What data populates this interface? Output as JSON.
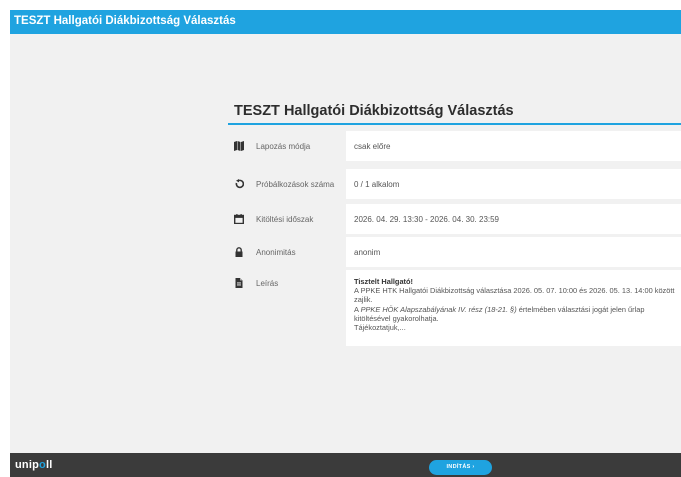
{
  "header": {
    "title": "TESZT Hallgatói Diákbizottság Választás"
  },
  "form": {
    "title": "TESZT Hallgatói Diákbizottság Választás",
    "rows": [
      {
        "icon": "map-book-icon",
        "label": "Lapozás módja",
        "value": "csak előre"
      },
      {
        "icon": "undo-arrow-icon",
        "label": "Próbálkozások száma",
        "value": "0 / 1 alkalom"
      },
      {
        "icon": "calendar-icon",
        "label": "Kitöltési időszak",
        "value": "2026. 04. 29. 13:30 - 2026. 04. 30. 23:59"
      },
      {
        "icon": "lock-icon",
        "label": "Anonimitás",
        "value": "anonim"
      },
      {
        "icon": "document-icon",
        "label": "Leírás"
      }
    ],
    "description": {
      "heading": "Tisztelt Hallgató!",
      "line1": "A PPKE HTK Hallgatói Diákbizottság választása 2026. 05. 07. 10:00 és 2026. 05. 13. 14:00 között zajlik.",
      "line2_prefix": "A ",
      "line2_italic": "PPKE HÖK Alapszabályának IV. rész (18-21. §)",
      "line2_suffix": " értelmében választási jogát jelen űrlap kitöltésével gyakorolhatja.",
      "line3": "Tájékoztatjuk,..."
    }
  },
  "footer": {
    "logo_prefix": "unip",
    "logo_accent": "o",
    "logo_suffix": "ll",
    "start_label": "INDÍTÁS ›"
  },
  "colors": {
    "accent": "#1fa3e0",
    "footer": "#3b3b3b",
    "background": "#f1f1f1"
  }
}
